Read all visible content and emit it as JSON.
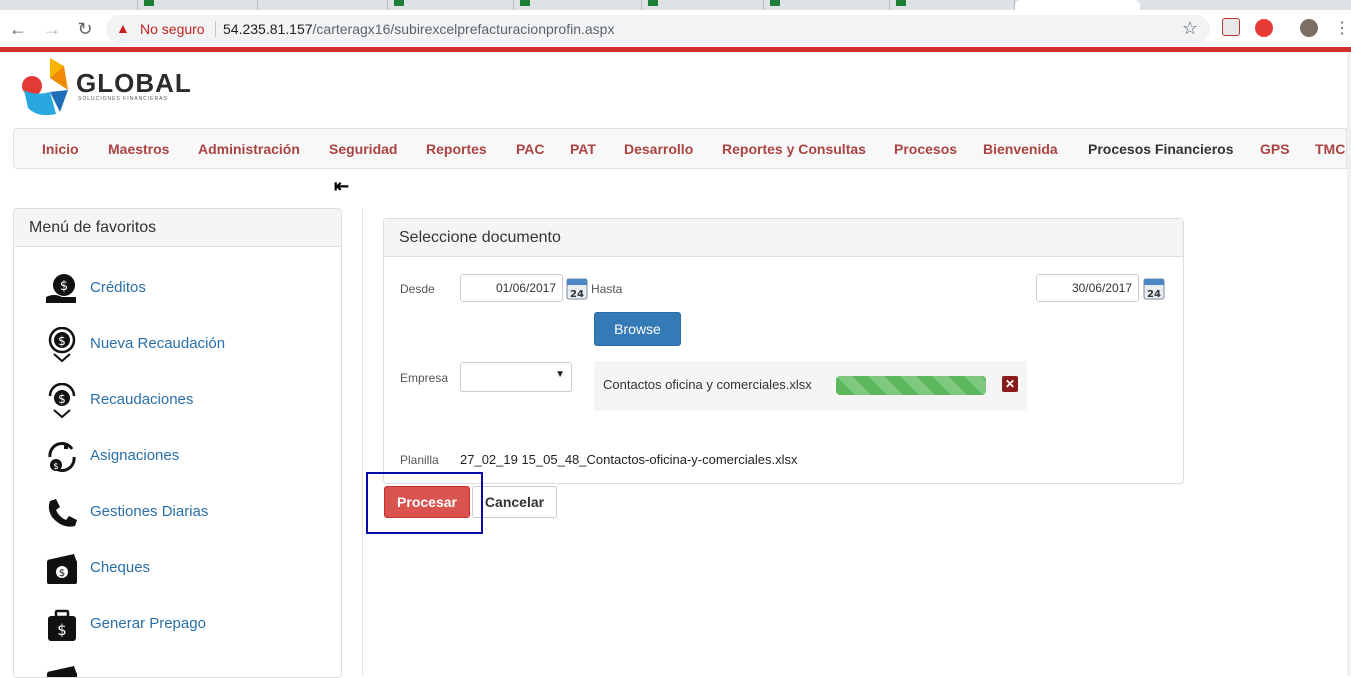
{
  "browser": {
    "not_secure": "No seguro",
    "url_host": "54.235.81.157",
    "url_path": "/carteragx16/subirexcelprefacturacionprofin.aspx"
  },
  "logo": {
    "name": "GLOBAL",
    "tagline": "SOLUCIONES FINANCIERAS"
  },
  "navbar": {
    "items": [
      "Inicio",
      "Maestros",
      "Administración",
      "Seguridad",
      "Reportes",
      "PAC",
      "PAT",
      "Desarrollo",
      "Reportes y Consultas",
      "Procesos",
      "Bienvenida",
      "Procesos Financieros",
      "GPS",
      "TMC"
    ]
  },
  "sidebar": {
    "title": "Menú de favoritos",
    "items": [
      {
        "label": "Créditos",
        "icon": "money-hand-icon"
      },
      {
        "label": "Nueva Recaudación",
        "icon": "money-location-icon"
      },
      {
        "label": "Recaudaciones",
        "icon": "money-location-icon"
      },
      {
        "label": "Asignaciones",
        "icon": "money-cycle-icon"
      },
      {
        "label": "Gestiones Diarias",
        "icon": "phone-icon"
      },
      {
        "label": "Cheques",
        "icon": "cash-stack-icon"
      },
      {
        "label": "Generar Prepago",
        "icon": "money-bag-icon"
      }
    ]
  },
  "form": {
    "panel_title": "Seleccione documento",
    "desde_label": "Desde",
    "desde_value": "01/06/2017",
    "hasta_label": "Hasta",
    "hasta_value": "30/06/2017",
    "calendar_day": "24",
    "browse_label": "Browse",
    "empresa_label": "Empresa",
    "empresa_value": "",
    "uploaded_file": "Contactos oficina y comerciales.xlsx",
    "upload_progress_percent": 100,
    "planilla_label": "Planilla",
    "planilla_value": "27_02_19 15_05_48_Contactos-oficina-y-comerciales.xlsx",
    "procesar_label": "Procesar",
    "cancelar_label": "Cancelar"
  },
  "colors": {
    "accent_red": "#a94442",
    "primary_blue": "#337ab7",
    "danger": "#d9534f",
    "success": "#5cb85c",
    "highlight": "#0a0aa8"
  }
}
